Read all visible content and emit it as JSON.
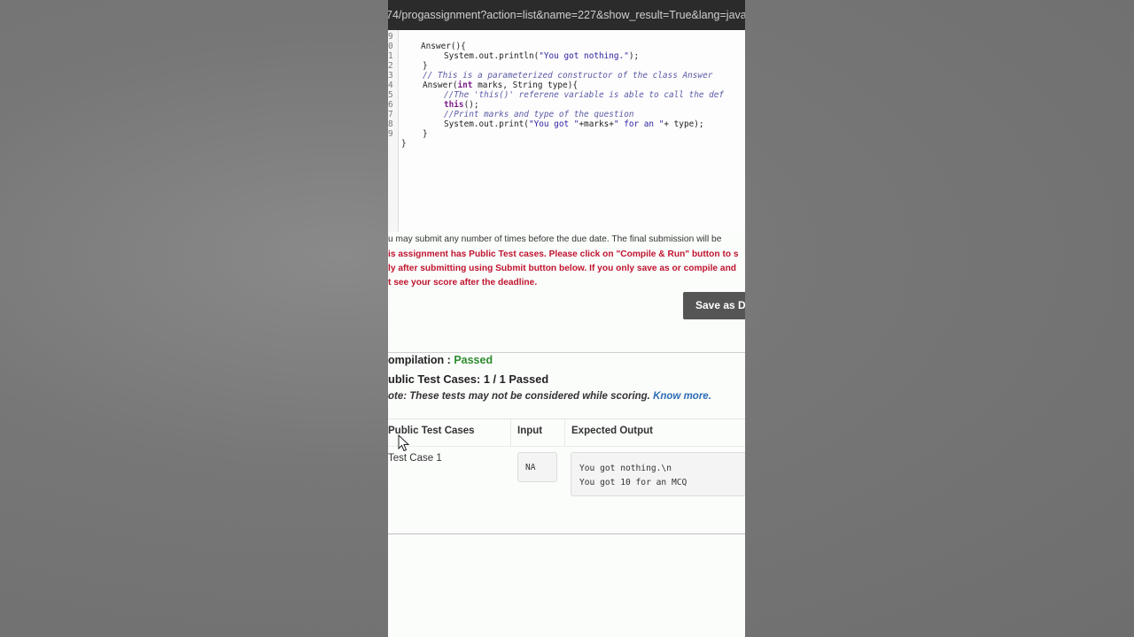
{
  "url": "74/progassignment?action=list&name=227&show_result=True&lang=java",
  "code_lines": [
    {
      "num": "9",
      "text": "Answer(){"
    },
    {
      "num": "0",
      "text": "System.out.println(\"You got nothing.\");"
    },
    {
      "num": "1",
      "text": "}"
    },
    {
      "num": "2",
      "text": "// This is a parameterized constructor of the class Answer"
    },
    {
      "num": "3",
      "text": "Answer(int marks, String type){"
    },
    {
      "num": "4",
      "text": "//The 'this()' referene variable is able to call the def"
    },
    {
      "num": "5",
      "text": "this();"
    },
    {
      "num": "6",
      "text": "//Print marks and type of the question"
    },
    {
      "num": "7",
      "text": "System.out.print(\"You got \"+marks+\" for an \"+ type);"
    },
    {
      "num": "8",
      "text": "}"
    },
    {
      "num": "9",
      "text": "}"
    }
  ],
  "notices": {
    "line1": "u may submit any number of times before the due date. The final submission will be",
    "line2": "is assignment has Public Test cases. Please click on \"Compile & Run\" button to s",
    "line3": "ly after submitting using Submit button below. If you only save as or compile and",
    "line4": "t see your score after the deadline."
  },
  "save_button": "Save as Dr",
  "compilation": {
    "label": "ompilation : ",
    "status": "Passed"
  },
  "public_tests": "ublic Test Cases: 1 / 1 Passed",
  "note": {
    "text": "ote: These tests may not be considered while scoring. ",
    "link": "Know more."
  },
  "table": {
    "headers": [
      "Public Test Cases",
      "Input",
      "Expected Output"
    ],
    "row": {
      "name": "Test Case 1",
      "input": "NA",
      "expected": [
        "You got nothing.\\n",
        "You got 10 for an MCQ"
      ]
    }
  }
}
